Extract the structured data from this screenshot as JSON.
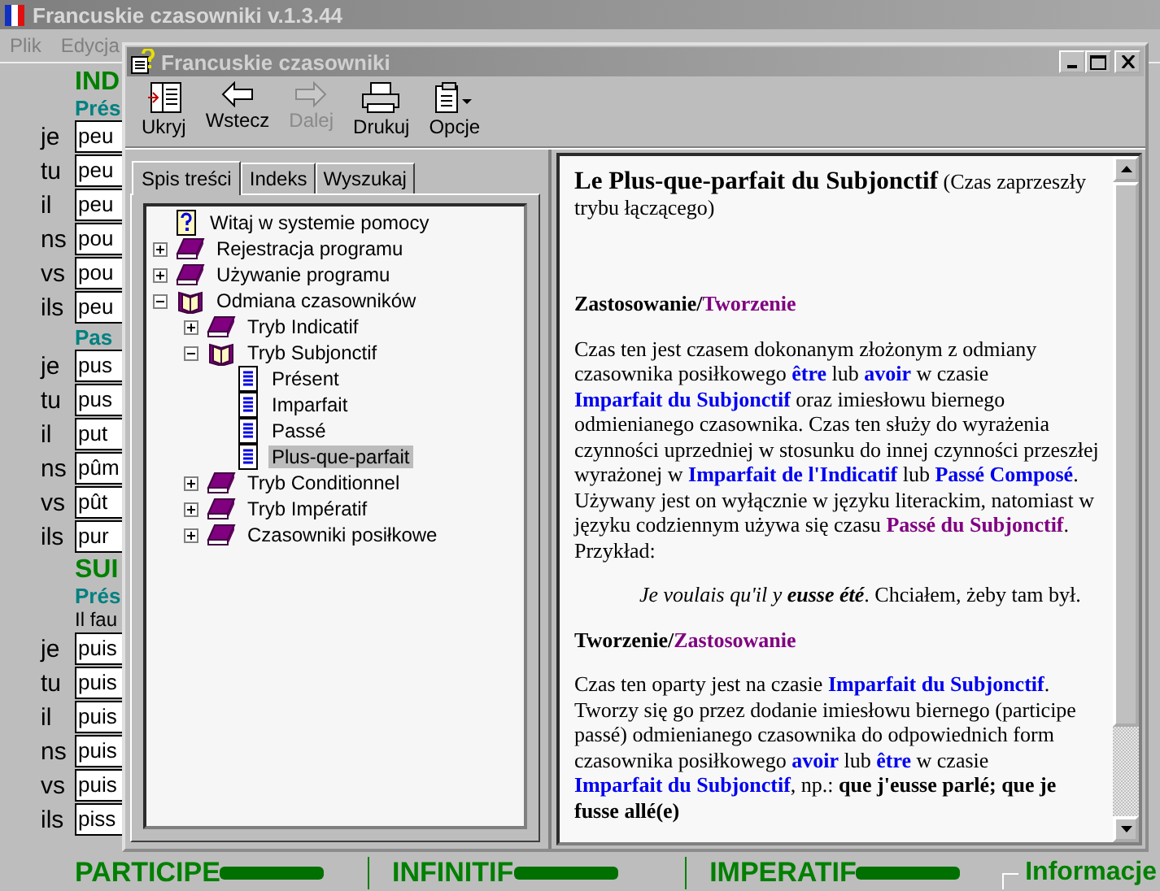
{
  "app": {
    "title": "Francuskie czasowniki v.1.3.44",
    "menu": [
      "Plik",
      "Edycja"
    ],
    "sections": [
      {
        "heading": "IND",
        "tense": "Prés",
        "rows": [
          {
            "pronoun": "je",
            "value": "peu"
          },
          {
            "pronoun": "tu",
            "value": "peu"
          },
          {
            "pronoun": "il",
            "value": "peu"
          },
          {
            "pronoun": "ns",
            "value": "pou"
          },
          {
            "pronoun": "vs",
            "value": "pou"
          },
          {
            "pronoun": "ils",
            "value": "peu"
          }
        ]
      },
      {
        "tense": "Pas",
        "rows": [
          {
            "pronoun": "je",
            "value": "pus"
          },
          {
            "pronoun": "tu",
            "value": "pus"
          },
          {
            "pronoun": "il",
            "value": "put"
          },
          {
            "pronoun": "ns",
            "value": "pûm"
          },
          {
            "pronoun": "vs",
            "value": "pût"
          },
          {
            "pronoun": "ils",
            "value": "pur"
          }
        ]
      },
      {
        "heading": "SUI",
        "tense": "Prés",
        "note": "Il fau",
        "rows": [
          {
            "pronoun": "je",
            "value": "puis"
          },
          {
            "pronoun": "tu",
            "value": "puis"
          },
          {
            "pronoun": "il",
            "value": "puis"
          },
          {
            "pronoun": "ns",
            "value": "puis"
          },
          {
            "pronoun": "vs",
            "value": "puis"
          },
          {
            "pronoun": "ils",
            "value": "piss"
          }
        ]
      }
    ],
    "footer": [
      {
        "label": "PARTICIPE"
      },
      {
        "label": "INFINITIF"
      },
      {
        "label": "IMPERATIF"
      }
    ],
    "info_checkbox": {
      "label": "Informacje",
      "checked": false
    }
  },
  "help": {
    "title": "Francuskie czasowniki",
    "toolbar": [
      {
        "kind": "hide",
        "label": "Ukryj",
        "disabled": false
      },
      {
        "kind": "back",
        "label": "Wstecz",
        "disabled": false
      },
      {
        "kind": "forward",
        "label": "Dalej",
        "disabled": true
      },
      {
        "kind": "print",
        "label": "Drukuj",
        "disabled": false
      },
      {
        "kind": "options",
        "label": "Opcje",
        "disabled": false
      }
    ],
    "tabs": [
      {
        "label": "Spis treści",
        "selected": true
      },
      {
        "label": "Indeks",
        "selected": false
      },
      {
        "label": "Wyszukaj",
        "selected": false
      }
    ],
    "tree": [
      {
        "label": "Witaj w systemie pomocy",
        "kind": "help",
        "selected": false
      },
      {
        "label": "Rejestracja programu",
        "kind": "book",
        "expanded": false,
        "selected": false
      },
      {
        "label": "Używanie programu",
        "kind": "book",
        "expanded": false,
        "selected": false
      },
      {
        "label": "Odmiana czasowników",
        "kind": "book",
        "expanded": true,
        "selected": false,
        "children": [
          {
            "label": "Tryb Indicatif",
            "kind": "book",
            "expanded": false,
            "selected": false
          },
          {
            "label": "Tryb Subjonctif",
            "kind": "book",
            "expanded": true,
            "selected": false,
            "children": [
              {
                "label": "Présent",
                "kind": "page",
                "selected": false
              },
              {
                "label": "Imparfait",
                "kind": "page",
                "selected": false
              },
              {
                "label": "Passé",
                "kind": "page",
                "selected": false
              },
              {
                "label": "Plus-que-parfait",
                "kind": "page",
                "selected": true
              }
            ]
          },
          {
            "label": "Tryb Conditionnel",
            "kind": "book",
            "expanded": false,
            "selected": false
          },
          {
            "label": "Tryb Impératif",
            "kind": "book",
            "expanded": false,
            "selected": false
          },
          {
            "label": "Czasowniki posiłkowe",
            "kind": "book",
            "expanded": false,
            "selected": false
          }
        ]
      }
    ],
    "content": {
      "heading": "**Le Plus-que-parfait du Subjonctif** (Czas zaprzeszły trybu łączącego)",
      "blocks": [
        {
          "kind": "subheading",
          "runs": [
            {
              "kind": "bold",
              "text": "Zastosowanie/"
            },
            {
              "kind": "visited",
              "text": "Tworzenie"
            }
          ]
        },
        {
          "kind": "paragraph",
          "runs": [
            {
              "kind": "plain",
              "text": "Czas ten jest czasem dokonanym złożonym z odmiany czasownika posiłkowego "
            },
            {
              "kind": "link",
              "text": "être"
            },
            {
              "kind": "plain",
              "text": " lub "
            },
            {
              "kind": "link",
              "text": "avoir"
            },
            {
              "kind": "plain",
              "text": " w czasie "
            },
            {
              "kind": "link",
              "text": "Imparfait du Subjonctif"
            },
            {
              "kind": "plain",
              "text": " oraz imiesłowu biernego odmienianego czasownika. Czas ten służy do wyrażenia czynności uprzedniej w stosunku do innej czynności przeszłej wyrażonej w "
            },
            {
              "kind": "link",
              "text": "Imparfait de l'Indicatif"
            },
            {
              "kind": "plain",
              "text": " lub "
            },
            {
              "kind": "link",
              "text": "Passé Composé"
            },
            {
              "kind": "plain",
              "text": ". Używany jest on wyłącznie w języku literackim, natomiast w języku codziennym używa się czasu "
            },
            {
              "kind": "visited",
              "text": "Passé du Subjonctif"
            },
            {
              "kind": "plain",
              "text": ". Przykład:"
            }
          ]
        },
        {
          "kind": "example",
          "runs": [
            {
              "kind": "italic",
              "text": "Je voulais qu'il y "
            },
            {
              "kind": "bold-italic",
              "text": "eusse été"
            },
            {
              "kind": "plain",
              "text": ". Chciałem, żeby tam był."
            }
          ]
        },
        {
          "kind": "subheading",
          "runs": [
            {
              "kind": "bold",
              "text": "Tworzenie/"
            },
            {
              "kind": "visited",
              "text": "Zastosowanie"
            }
          ]
        },
        {
          "kind": "paragraph",
          "runs": [
            {
              "kind": "plain",
              "text": "Czas ten oparty jest na czasie "
            },
            {
              "kind": "link",
              "text": "Imparfait du Subjonctif"
            },
            {
              "kind": "plain",
              "text": ". Tworzy się go przez dodanie imiesłowu biernego (participe passé) odmienianego czasownika do odpowiednich form czasownika posiłkowego "
            },
            {
              "kind": "link",
              "text": "avoir"
            },
            {
              "kind": "plain",
              "text": " lub "
            },
            {
              "kind": "link",
              "text": "être"
            },
            {
              "kind": "plain",
              "text": " w czasie "
            },
            {
              "kind": "link",
              "text": "Imparfait du Subjonctif"
            },
            {
              "kind": "plain",
              "text": ", np.: "
            },
            {
              "kind": "bold",
              "text": "que j'eusse parlé; que je fusse allé(e)"
            }
          ]
        }
      ]
    }
  }
}
